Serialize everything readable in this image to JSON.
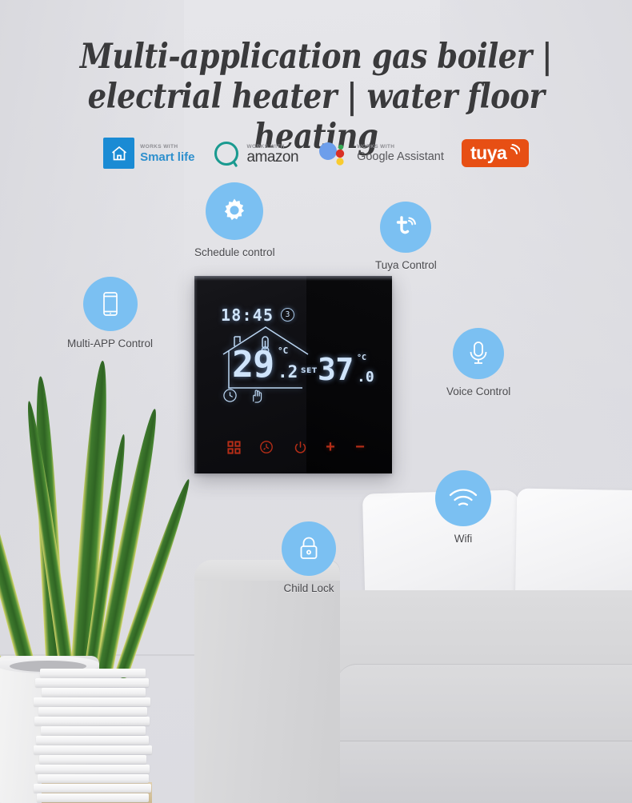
{
  "headline": {
    "line1": "Multi-application gas boiler |",
    "line2": "electrial heater | water floor heating"
  },
  "badges": [
    {
      "icon": "smart-life-house-icon",
      "works_with": "WORKS WITH",
      "brand": "Smart life",
      "color": "#1a8bd4"
    },
    {
      "icon": "alexa-ring-icon",
      "works_with": "WORKS WITH",
      "brand": "amazon",
      "color": "#1a9a90"
    },
    {
      "icon": "google-assistant-dots-icon",
      "works_with": "WORKS WITH",
      "brand": "Google Assistant",
      "color": "#4285f4"
    },
    {
      "icon": "tuya-logo-icon",
      "works_with": "",
      "brand": "tuya",
      "color": "#e74f14"
    }
  ],
  "features": [
    {
      "id": "schedule",
      "icon": "gear-icon",
      "label": "Schedule control"
    },
    {
      "id": "tuya",
      "icon": "tuya-t-signal-icon",
      "label": "Tuya Control"
    },
    {
      "id": "app",
      "icon": "smartphone-icon",
      "label": "Multi-APP Control"
    },
    {
      "id": "voice",
      "icon": "microphone-icon",
      "label": "Voice Control"
    },
    {
      "id": "wifi",
      "icon": "wifi-icon",
      "label": "Wifi"
    },
    {
      "id": "lock",
      "icon": "padlock-icon",
      "label": "Child Lock"
    }
  ],
  "thermostat": {
    "time": "18:45",
    "day_indicator": "3",
    "current_temp": "29",
    "current_temp_decimal": ".2",
    "current_temp_unit": "°C",
    "set_label": "SET",
    "set_temp": "37",
    "set_temp_decimal": ".0",
    "set_temp_unit": "°C",
    "mode_icons": [
      "clock-icon",
      "hand-icon"
    ],
    "house_icon": "house-thermometer-icon",
    "buttons": [
      {
        "name": "menu-button",
        "icon": "grid-icon",
        "symbol": ""
      },
      {
        "name": "timer-button",
        "icon": "timer-clock-icon",
        "symbol": ""
      },
      {
        "name": "power-button",
        "icon": "power-icon",
        "symbol": ""
      },
      {
        "name": "increase-button",
        "icon": "plus-icon",
        "symbol": "+"
      },
      {
        "name": "decrease-button",
        "icon": "minus-icon",
        "symbol": "−"
      }
    ],
    "accent_color": "#b42d17",
    "lcd_color": "#cfe4fb"
  },
  "theme": {
    "bubble_color": "#7bc0f2",
    "label_color": "#4a4a4e",
    "headline_color": "#3a3a3c"
  }
}
